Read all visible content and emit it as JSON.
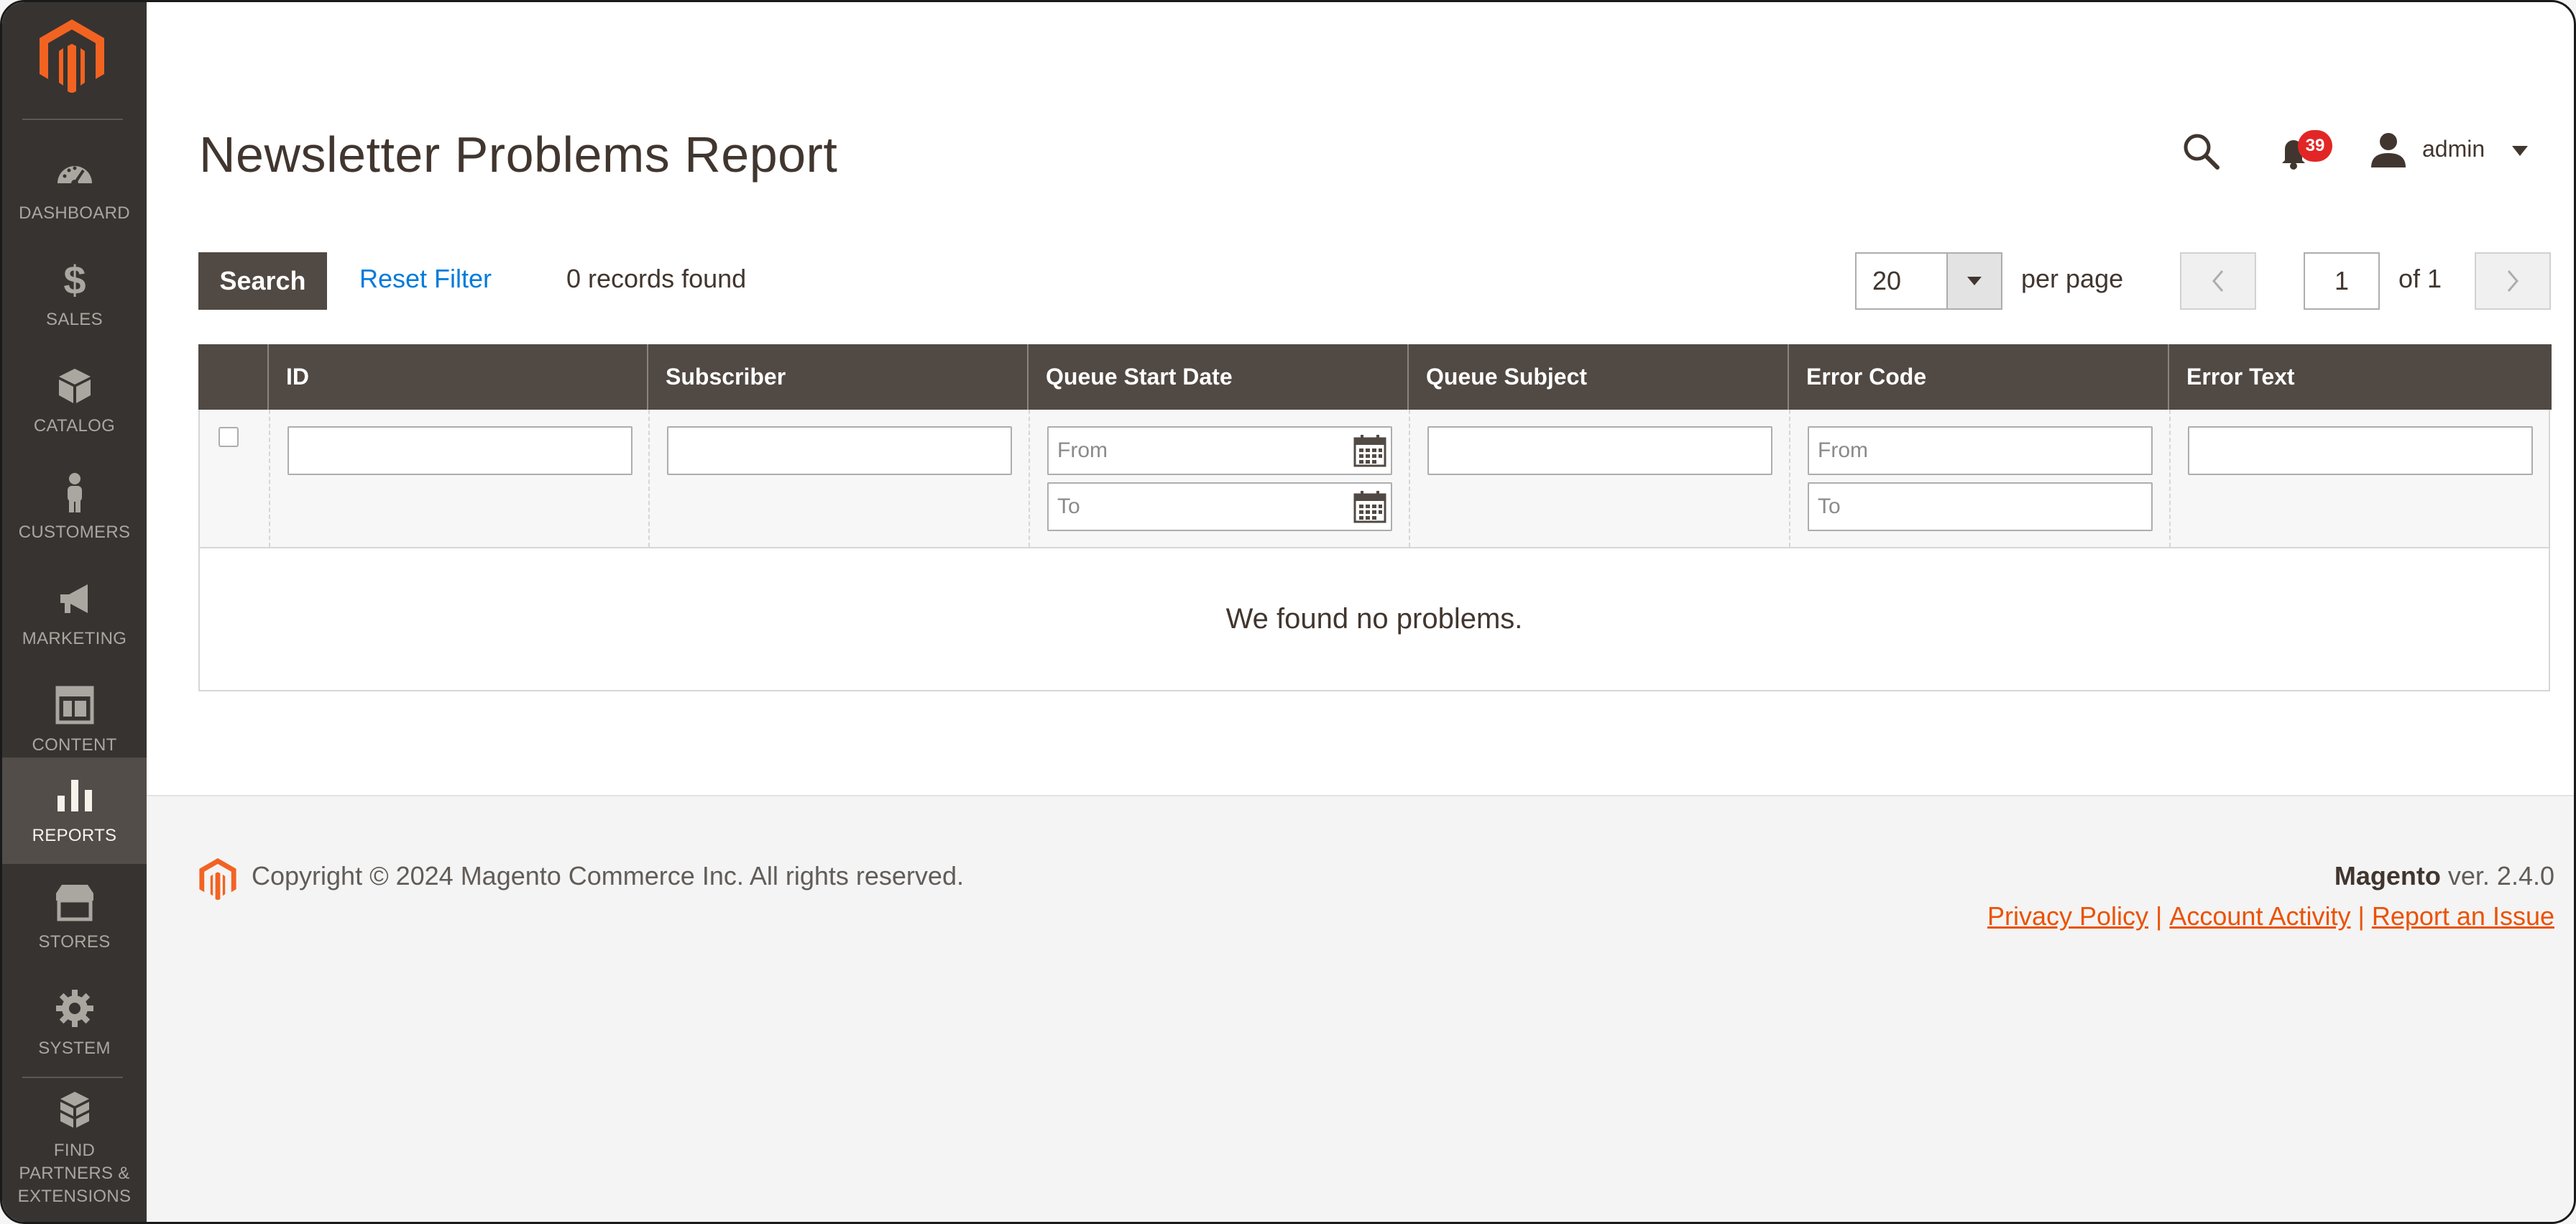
{
  "sidebar": {
    "items": [
      {
        "label": "DASHBOARD",
        "icon": "dashboard-icon"
      },
      {
        "label": "SALES",
        "icon": "dollar-icon"
      },
      {
        "label": "CATALOG",
        "icon": "cube-icon"
      },
      {
        "label": "CUSTOMERS",
        "icon": "person-icon"
      },
      {
        "label": "MARKETING",
        "icon": "megaphone-icon"
      },
      {
        "label": "CONTENT",
        "icon": "layout-icon"
      },
      {
        "label": "REPORTS",
        "icon": "bar-chart-icon"
      },
      {
        "label": "STORES",
        "icon": "storefront-icon"
      },
      {
        "label": "SYSTEM",
        "icon": "gear-icon"
      },
      {
        "label": "FIND PARTNERS & EXTENSIONS",
        "icon": "boxes-icon"
      }
    ],
    "active": "REPORTS"
  },
  "header": {
    "title": "Newsletter Problems Report",
    "notification_count": "39",
    "user": "admin"
  },
  "toolbar": {
    "search_label": "Search",
    "reset_label": "Reset Filter",
    "records_found": "0 records found",
    "per_page_value": "20",
    "per_page_label": "per page",
    "current_page": "1",
    "page_total": "of 1"
  },
  "grid": {
    "columns": [
      "ID",
      "Subscriber",
      "Queue Start Date",
      "Queue Subject",
      "Error Code",
      "Error Text"
    ],
    "placeholders": {
      "from": "From",
      "to": "To"
    },
    "empty_message": "We found no problems."
  },
  "footer": {
    "copyright": "Copyright © 2024 Magento Commerce Inc. All rights reserved.",
    "brand": "Magento",
    "version": " ver. 2.4.0",
    "links": [
      "Privacy Policy",
      "Account Activity",
      "Report an Issue"
    ]
  },
  "colors": {
    "sidebar_bg": "#373330",
    "sidebar_active": "#524d49",
    "brand_orange": "#eb5202",
    "header_bg": "#514943",
    "link_blue": "#007bdb",
    "badge_red": "#e22626"
  }
}
